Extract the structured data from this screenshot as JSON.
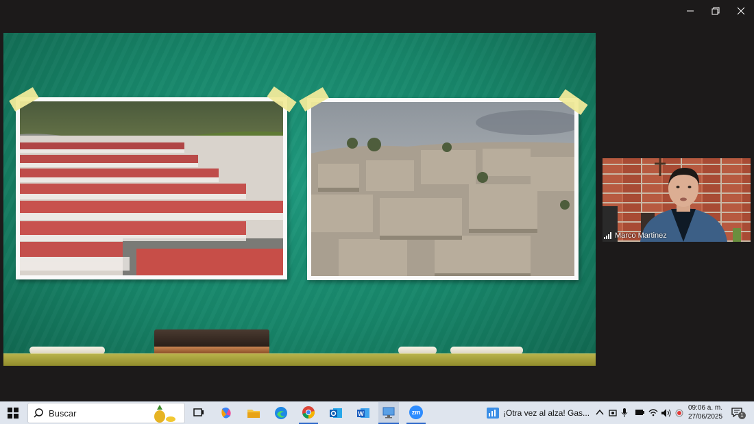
{
  "window": {
    "minimize_icon": "minimize-icon",
    "restore_icon": "restore-icon",
    "close_icon": "close-icon"
  },
  "presentation": {
    "background": "green chalkboard",
    "photos": [
      "row-houses-photo",
      "hillside-settlement-photo"
    ]
  },
  "participant": {
    "name": "Marco Martinez"
  },
  "taskbar": {
    "search_label": "Buscar",
    "apps": [
      "task-view-icon",
      "copilot-icon",
      "file-explorer-icon",
      "edge-icon",
      "chrome-icon",
      "outlook-icon",
      "word-icon",
      "remote-desktop-icon",
      "zoom-icon"
    ],
    "zoom_label": "zm",
    "news_text": "¡Otra vez al alza! Gas...",
    "time": "09:06 a. m.",
    "date": "27/06/2025",
    "notification_count": "1"
  },
  "colors": {
    "chalkboard": "#178569",
    "taskbar": "#dfe5ee",
    "window_bg": "#1c1a1a",
    "tape": "#f0ea9a"
  }
}
